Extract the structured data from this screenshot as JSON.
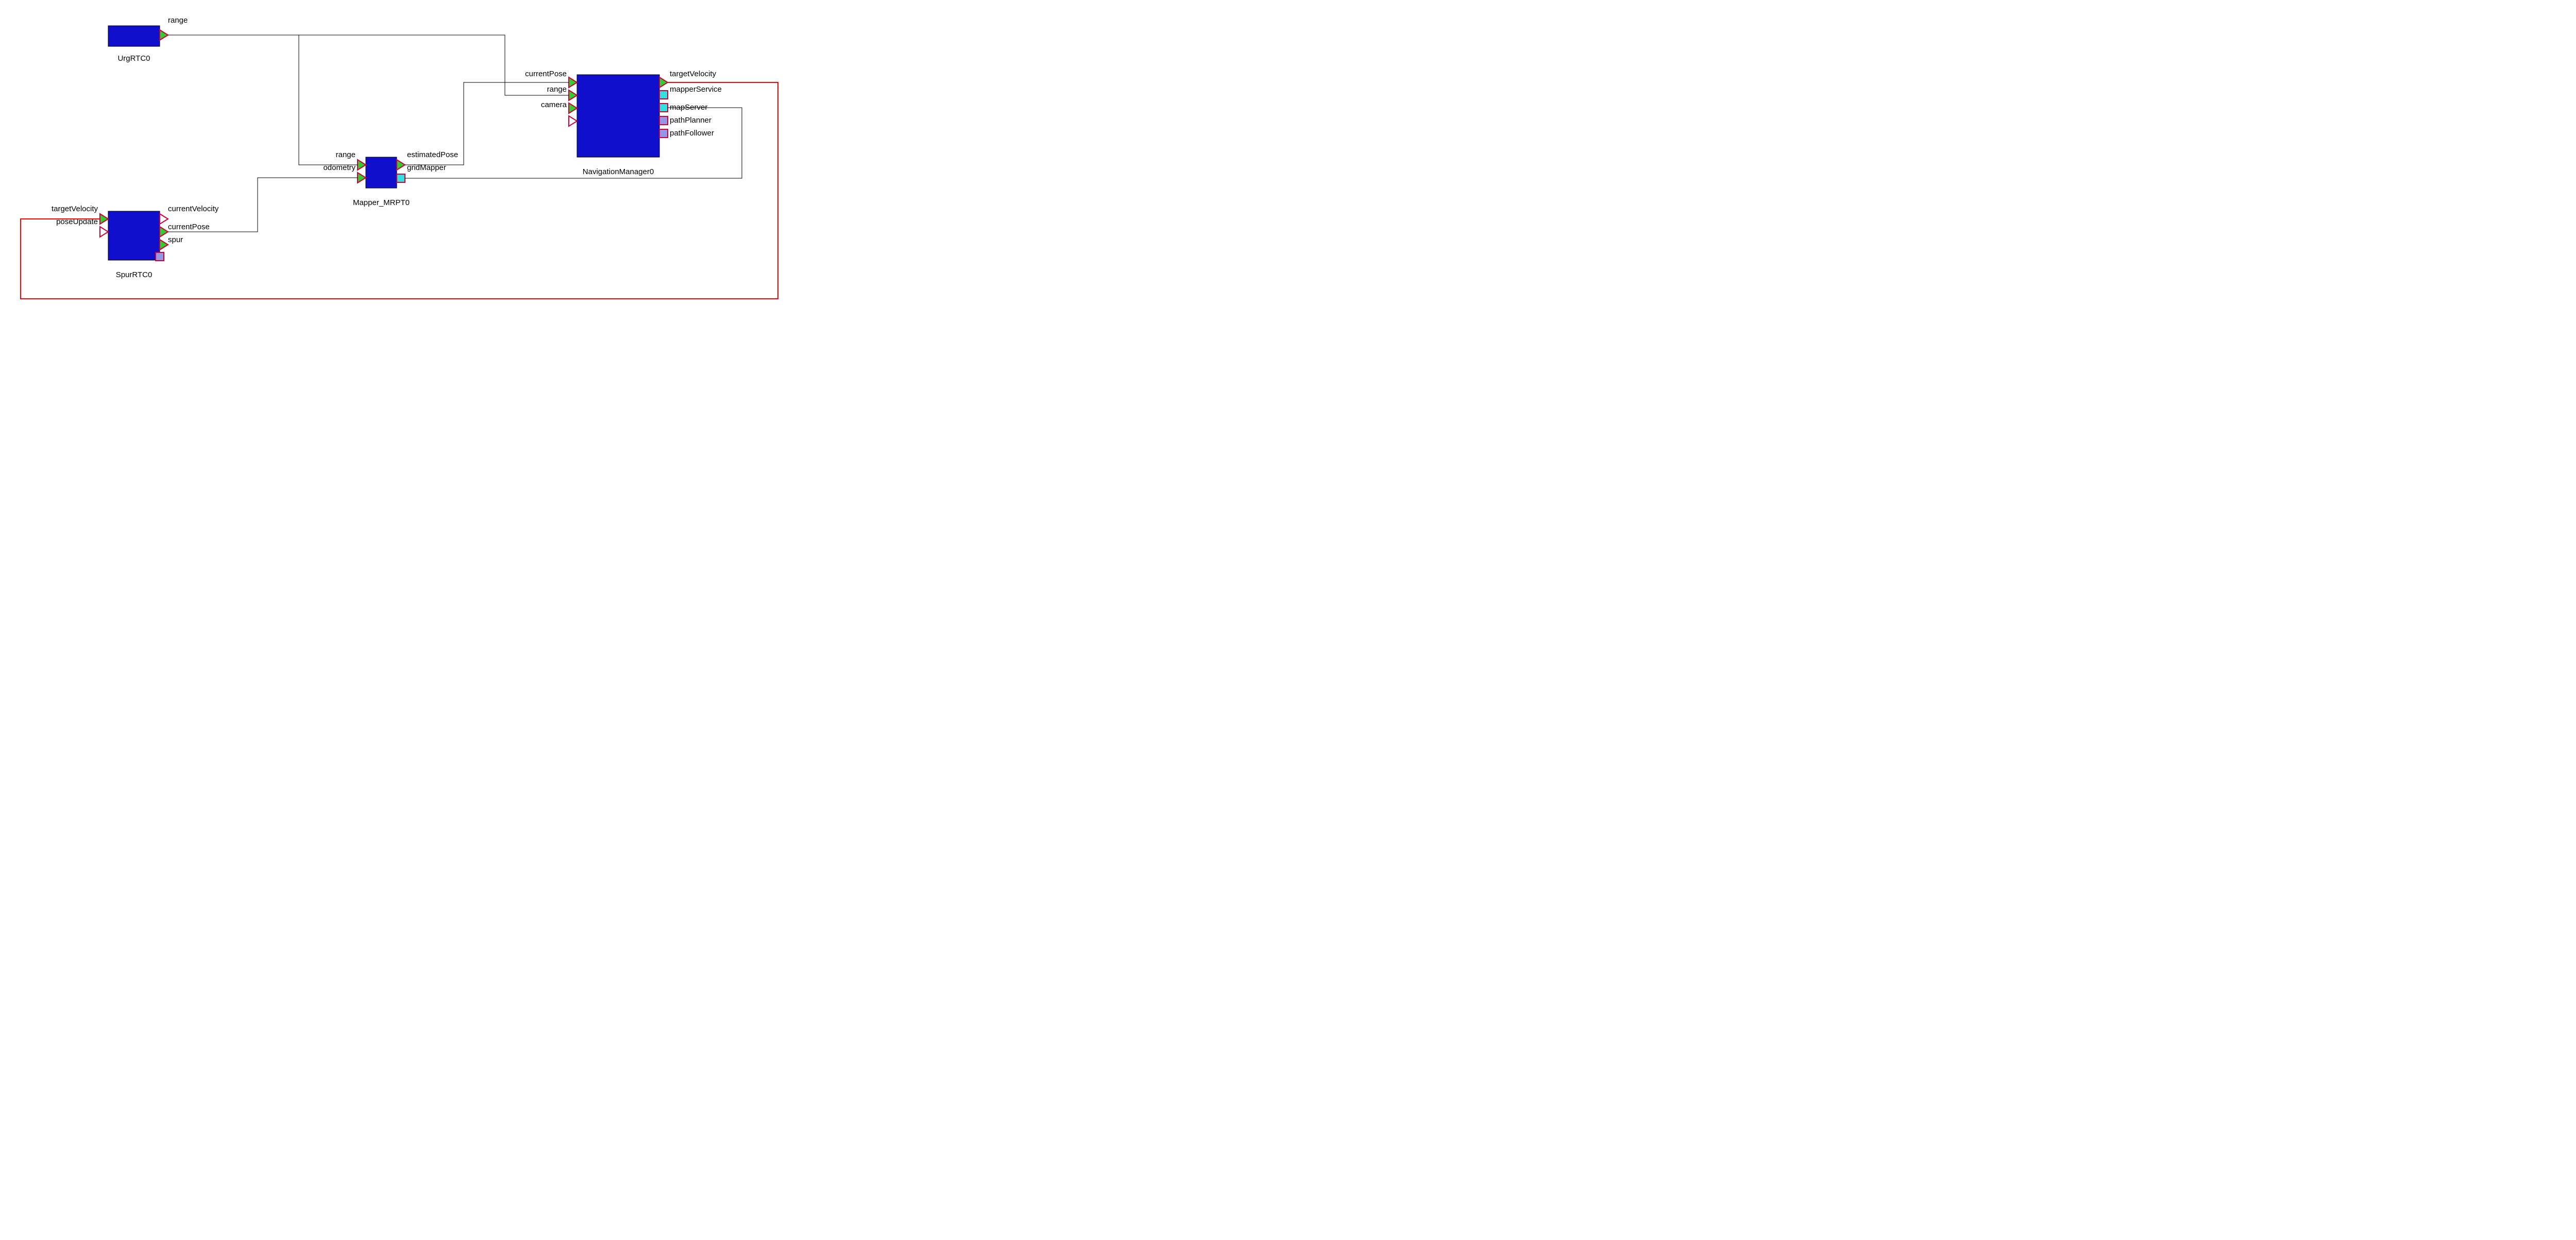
{
  "components": {
    "urg": {
      "name": "UrgRTC0",
      "ports": {
        "range": "range"
      }
    },
    "spur": {
      "name": "SpurRTC0",
      "ports": {
        "targetVelocity": "targetVelocity",
        "poseUpdate": "poseUpdate",
        "currentVelocity": "currentVelocity",
        "currentPose": "currentPose",
        "spur": "spur"
      }
    },
    "mapper": {
      "name": "Mapper_MRPT0",
      "ports": {
        "range": "range",
        "odometry": "odometry",
        "estimatedPose": "estimatedPose",
        "gridMapper": "gridMapper"
      }
    },
    "nav": {
      "name": "NavigationManager0",
      "ports": {
        "currentPose": "currentPose",
        "range": "range",
        "camera": "camera",
        "targetVelocity": "targetVelocity",
        "mapperService": "mapperService",
        "mapServer": "mapServer",
        "pathPlanner": "pathPlanner",
        "pathFollower": "pathFollower"
      }
    }
  }
}
